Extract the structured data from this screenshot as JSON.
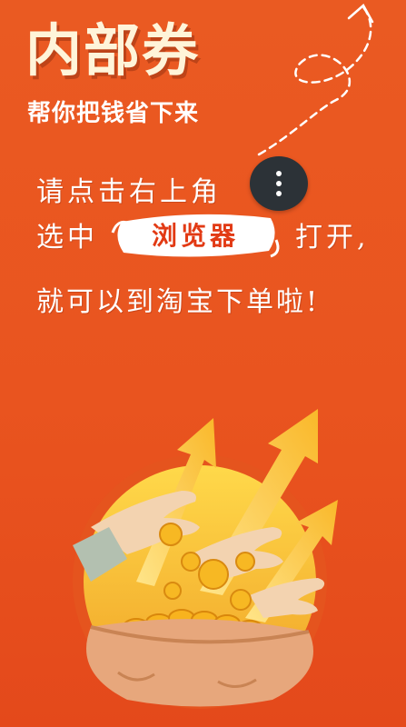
{
  "header": {
    "title": "内部券",
    "subtitle": "帮你把钱省下来"
  },
  "instructions": {
    "line1": "请点击右上角",
    "line2_prefix": "选中",
    "browser_label": "浏览器",
    "line2_suffix": "打开,",
    "line3": "就可以到淘宝下单啦!"
  },
  "icons": {
    "menu": "more-vertical-icon",
    "arrow": "curved-arrow-icon",
    "illustration": "money-bag-illustration"
  },
  "colors": {
    "background": "#ea5a22",
    "title": "#fff4d9",
    "menu_button": "#2c3237",
    "badge_text": "#e23a14"
  }
}
